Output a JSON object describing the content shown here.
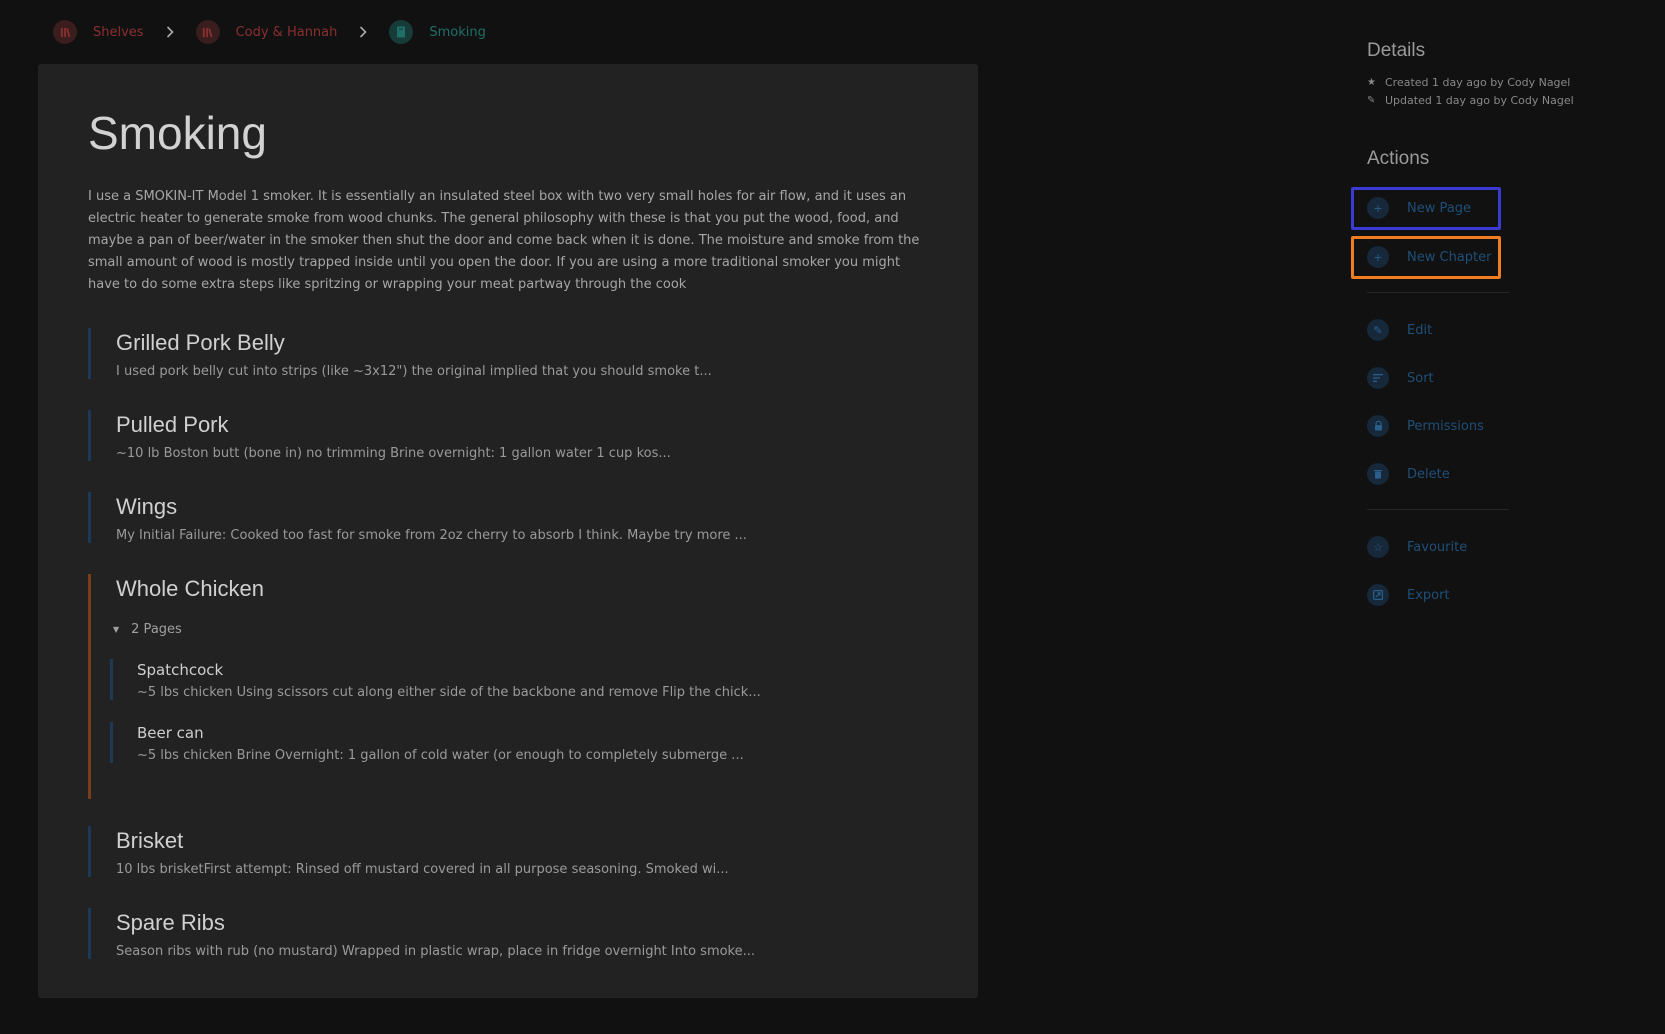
{
  "breadcrumbs": [
    {
      "label": "Shelves",
      "icon": "shelves-icon"
    },
    {
      "label": "Cody & Hannah",
      "icon": "shelves-icon"
    },
    {
      "label": "Smoking",
      "icon": "book-icon"
    }
  ],
  "book": {
    "title": "Smoking",
    "description": "I use a SMOKIN-IT Model 1 smoker. It is essentially an insulated steel box with two very small holes for air flow, and it uses an electric heater to generate smoke from wood chunks. The general philosophy with these is that you put the wood, food, and maybe a pan of beer/water in the smoker then shut the door and come back when it is done. The moisture and smoke from the small amount of wood is mostly trapped inside until you open the door. If you are using a more traditional smoker you might have to do some extra steps like spritzing or wrapping your meat partway through the cook"
  },
  "contents": [
    {
      "title": "Grilled Pork Belly",
      "excerpt": "I used pork belly cut into strips (like ~3x12\")      the original implied that you should smoke t..."
    },
    {
      "title": "Pulled Pork",
      "excerpt": "~10 lb Boston butt (bone in) no trimming Brine overnight: 1 gallon water 1 cup kos..."
    },
    {
      "title": "Wings",
      "excerpt": "My Initial Failure: Cooked too fast for smoke from 2oz cherry to absorb I think. Maybe try more ..."
    },
    {
      "title": "Whole Chicken",
      "toggle_label": "2 Pages",
      "pages": [
        {
          "title": "Spatchcock",
          "excerpt": "~5 lbs chicken Using scissors cut along either side of the backbone and remove Flip the chick..."
        },
        {
          "title": "Beer can",
          "excerpt": "~5 lbs chicken Brine Overnight: 1 gallon of cold water (or enough to completely submerge ..."
        }
      ]
    },
    {
      "title": "Brisket",
      "excerpt": "10 lbs brisketFirst attempt: Rinsed off mustard covered in all purpose seasoning. Smoked wi..."
    },
    {
      "title": "Spare Ribs",
      "excerpt": "Season ribs with rub (no mustard) Wrapped in plastic wrap, place in fridge overnight Into smoke..."
    }
  ],
  "details": {
    "heading": "Details",
    "created": "Created 1 day ago by Cody Nagel",
    "updated": "Updated 1 day ago by Cody Nagel"
  },
  "actions": {
    "heading": "Actions",
    "items": [
      {
        "label": "New Page",
        "icon": "plus-icon"
      },
      {
        "label": "New Chapter",
        "icon": "plus-icon"
      },
      {
        "label": "Edit",
        "icon": "pencil-icon"
      },
      {
        "label": "Sort",
        "icon": "sort-icon"
      },
      {
        "label": "Permissions",
        "icon": "lock-icon"
      },
      {
        "label": "Delete",
        "icon": "trash-icon"
      },
      {
        "label": "Favourite",
        "icon": "star-icon"
      },
      {
        "label": "Export",
        "icon": "export-icon"
      }
    ]
  },
  "highlight_colors": {
    "new_page": "#3b3bd4",
    "new_chapter": "#f07d22"
  }
}
